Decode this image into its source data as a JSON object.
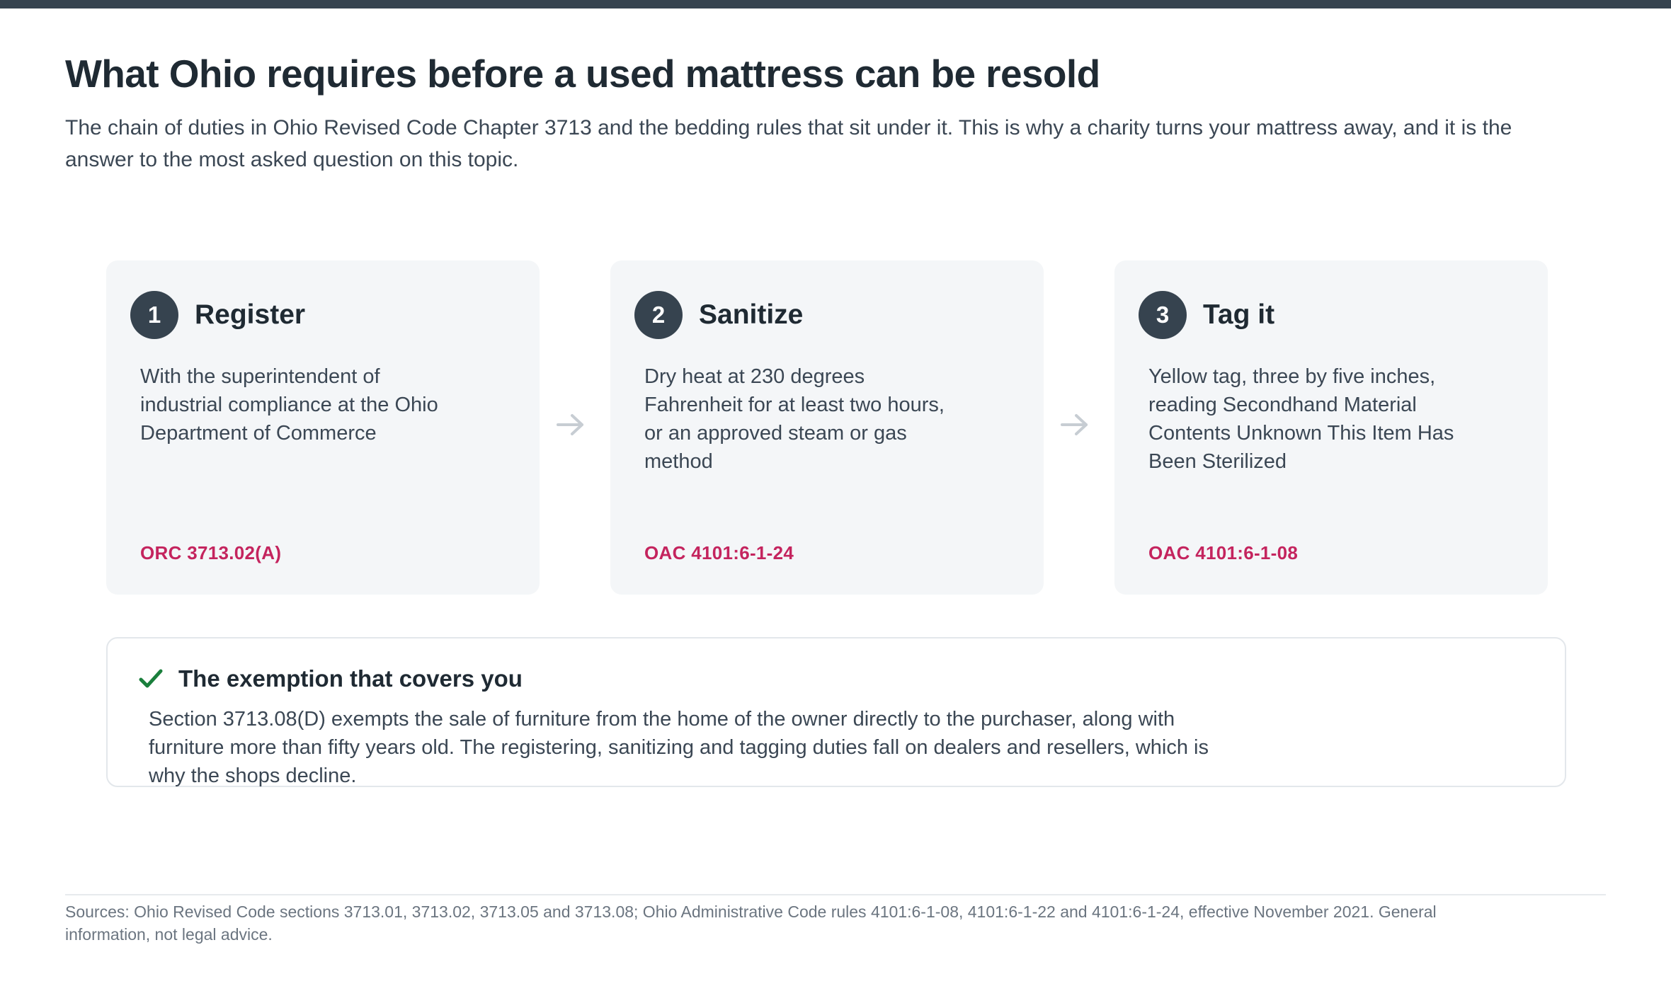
{
  "header": {
    "title": "What Ohio requires before a used mattress can be resold",
    "intro": "The chain of duties in Ohio Revised Code Chapter 3713 and the bedding rules that sit under it. This is why a charity turns your mattress away, and it is the answer to the most asked question on this topic."
  },
  "steps": [
    {
      "number": "1",
      "title": "Register",
      "body": "With the superintendent of industrial compliance at the Ohio Department of Commerce",
      "citation": "ORC 3713.02(A)"
    },
    {
      "number": "2",
      "title": "Sanitize",
      "body": "Dry heat at 230 degrees Fahrenheit for at least two hours, or an approved steam or gas method",
      "citation": "OAC 4101:6-1-24"
    },
    {
      "number": "3",
      "title": "Tag it",
      "body": "Yellow tag, three by five inches, reading Secondhand Material Contents Unknown This Item Has Been Sterilized",
      "citation": "OAC 4101:6-1-08"
    }
  ],
  "exemption": {
    "title": "The exemption that covers you",
    "body": "Section 3713.08(D) exempts the sale of furniture from the home of the owner directly to the purchaser, along with furniture more than fifty years old. The registering, sanitizing and tagging duties fall on dealers and resellers, which is why the shops decline."
  },
  "footer": {
    "sources": "Sources: Ohio Revised Code sections 3713.01, 3713.02, 3713.05 and 3713.08; Ohio Administrative Code rules 4101:6-1-08, 4101:6-1-22 and 4101:6-1-24, effective November 2021. General information, not legal advice."
  },
  "icons": {
    "step_connector": "arrow-right-icon",
    "exemption_marker": "check-icon"
  },
  "colors": {
    "accent_dark": "#36434f",
    "citation": "#c4245e",
    "check": "#1a7f3c",
    "card_background": "#f4f6f8"
  }
}
